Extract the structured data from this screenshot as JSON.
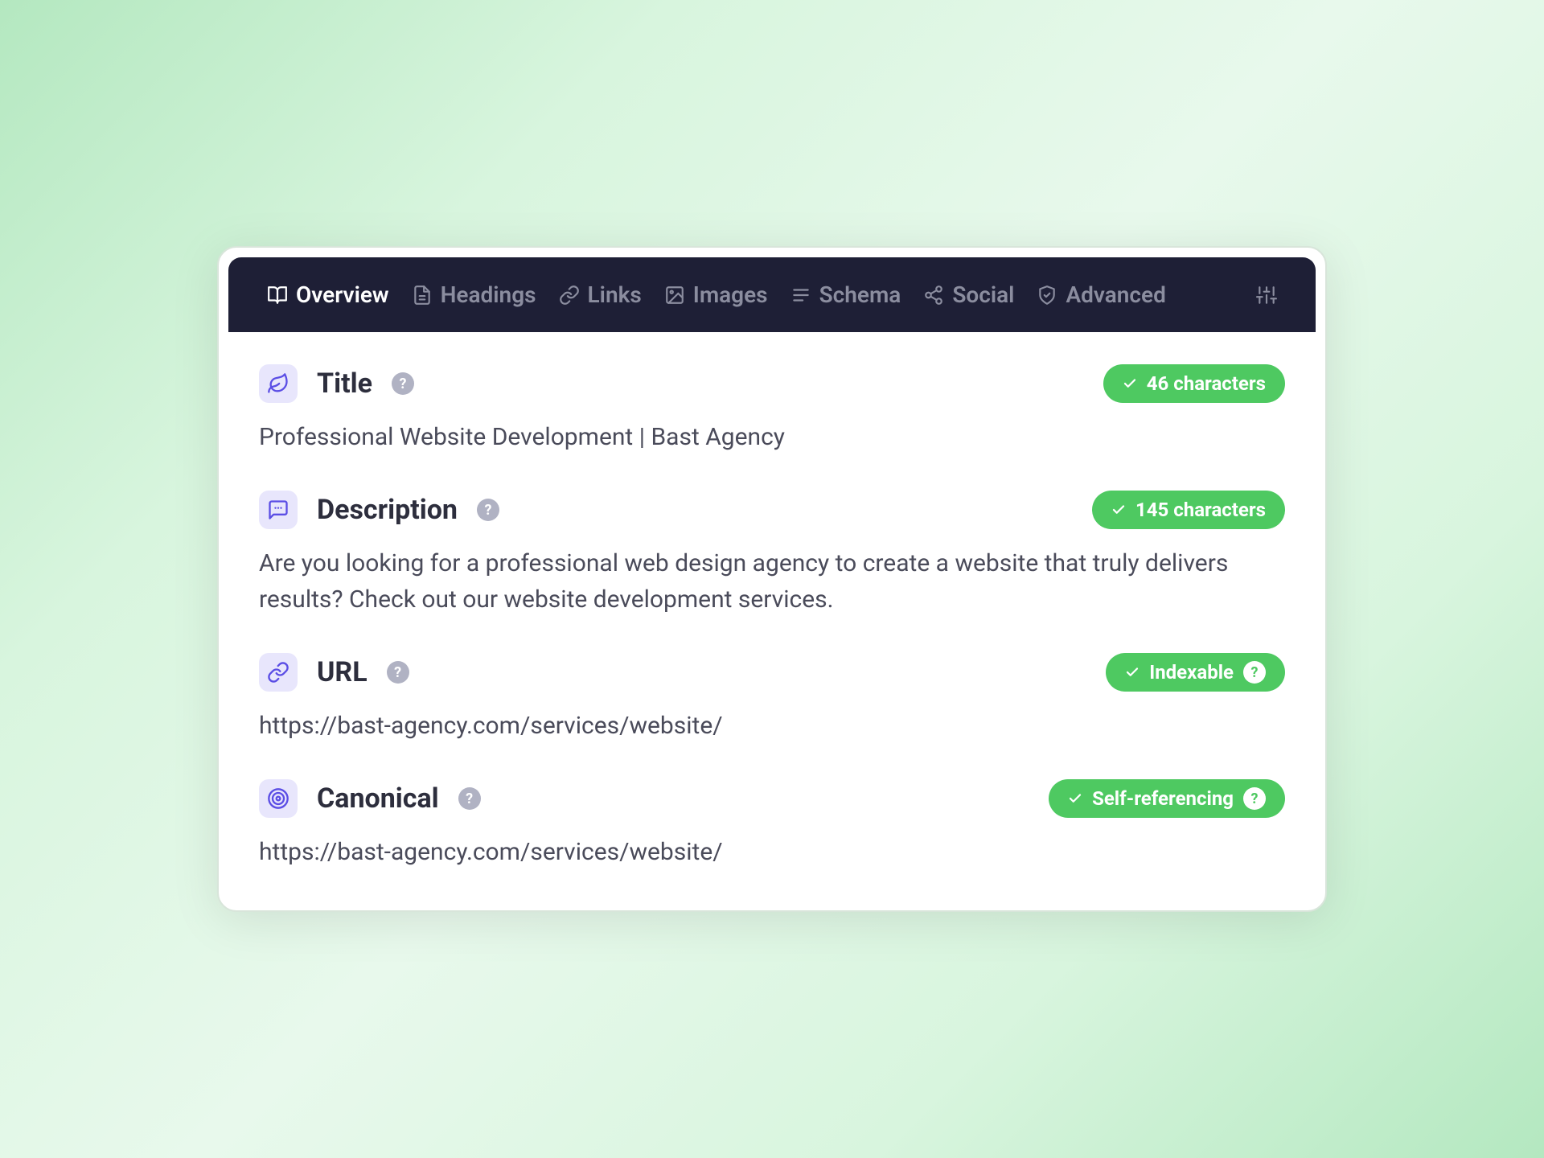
{
  "nav": {
    "items": [
      {
        "label": "Overview",
        "icon": "book"
      },
      {
        "label": "Headings",
        "icon": "file"
      },
      {
        "label": "Links",
        "icon": "link"
      },
      {
        "label": "Images",
        "icon": "image"
      },
      {
        "label": "Schema",
        "icon": "list"
      },
      {
        "label": "Social",
        "icon": "share"
      },
      {
        "label": "Advanced",
        "icon": "shield"
      }
    ]
  },
  "sections": {
    "title": {
      "label": "Title",
      "value": "Professional Website Development | Bast Agency",
      "badge": "46 characters"
    },
    "description": {
      "label": "Description",
      "value": "Are you looking for a professional web design agency to create a website that truly delivers results? Check out our website development services.",
      "badge": "145 characters"
    },
    "url": {
      "label": "URL",
      "value": "https://bast-agency.com/services/website/",
      "badge": "Indexable"
    },
    "canonical": {
      "label": "Canonical",
      "value": "https://bast-agency.com/services/website/",
      "badge": "Self-referencing"
    }
  },
  "colors": {
    "accent": "#5b4ee5",
    "success": "#4ec961",
    "navBg": "#1e1f36"
  }
}
